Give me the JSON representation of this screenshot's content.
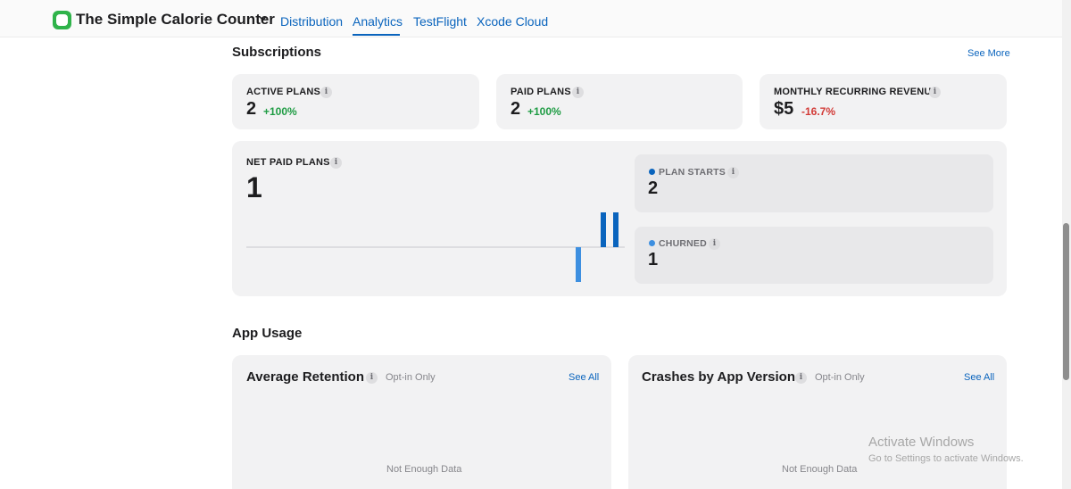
{
  "nav": {
    "app_title": "The Simple Calorie Counter",
    "tabs": [
      {
        "label": "Distribution"
      },
      {
        "label": "Analytics"
      },
      {
        "label": "TestFlight"
      },
      {
        "label": "Xcode Cloud"
      }
    ],
    "active_tab": "Analytics"
  },
  "subscriptions": {
    "title": "Subscriptions",
    "see_more": "See More",
    "active_plans": {
      "label": "ACTIVE PLANS",
      "value": "2",
      "delta": "+100%"
    },
    "paid_plans": {
      "label": "PAID PLANS",
      "value": "2",
      "delta": "+100%"
    },
    "mrr": {
      "label": "MONTHLY RECURRING REVENUE",
      "value": "$5",
      "delta": "-16.7%"
    },
    "net_paid_plans": {
      "label": "NET PAID PLANS",
      "value": "1"
    },
    "plan_starts": {
      "label": "PLAN STARTS",
      "value": "2"
    },
    "churned": {
      "label": "CHURNED",
      "value": "1"
    }
  },
  "chart_data": {
    "type": "bar",
    "series": [
      {
        "name": "PLAN STARTS",
        "values": [
          1,
          1
        ],
        "color": "#0a64bd"
      },
      {
        "name": "CHURNED",
        "values": [
          -1
        ],
        "color": "#3d8fe0"
      }
    ],
    "title": "NET PAID PLANS",
    "ylim": [
      -1,
      1
    ]
  },
  "app_usage": {
    "title": "App Usage",
    "retention": {
      "title": "Average Retention",
      "optin": "Opt-in Only",
      "see_all": "See All",
      "empty": "Not Enough Data"
    },
    "crashes": {
      "title": "Crashes by App Version",
      "optin": "Opt-in Only",
      "see_all": "See All",
      "empty": "Not Enough Data"
    }
  },
  "watermark": {
    "line1": "Activate Windows",
    "line2": "Go to Settings to activate Windows."
  },
  "colors": {
    "accent": "#0a64bd",
    "positive": "#1f9c44",
    "negative": "#d23a36",
    "app_icon": "#2fb34a"
  }
}
